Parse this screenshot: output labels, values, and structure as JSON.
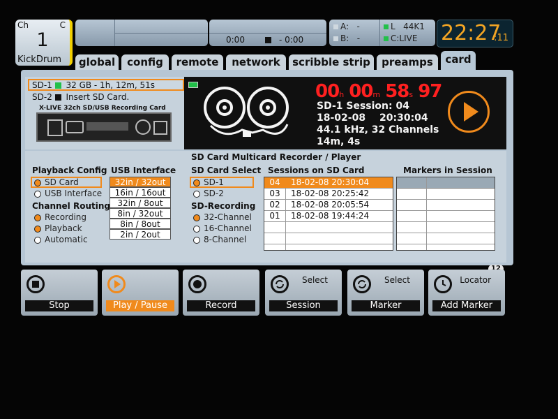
{
  "channel": {
    "ch_label": "Ch",
    "c_label": "C",
    "number": "1",
    "name": "KickDrum"
  },
  "transport": {
    "elapsed": "0:00",
    "remaining": "- 0:00"
  },
  "io": {
    "a_label": "A:",
    "a_val": "-",
    "b_label": "B:",
    "b_val": "-",
    "l_label": "L",
    "l_val": "44K1",
    "c_label": "C:",
    "c_val": "LIVE"
  },
  "clock": {
    "hm": "22:27",
    "s": ":11"
  },
  "tabs": [
    "global",
    "config",
    "remote",
    "network",
    "scribble strip",
    "preamps",
    "card"
  ],
  "sd_status": [
    {
      "label": "SD-1",
      "text": "32 GB - 1h, 12m, 51s",
      "status_color": "#22c04a"
    },
    {
      "label": "SD-2",
      "text": "Insert SD Card.",
      "status_color": "#111111"
    }
  ],
  "card_image_title": "X-LIVE 32ch SD/USB Recording Card",
  "battery_color": "#22c04a",
  "timer": {
    "h": "00",
    "h_unit": "h",
    "m": "00",
    "m_unit": "m",
    "s": "58",
    "s_unit": "s",
    "f": "97"
  },
  "session_info": {
    "line1": "SD-1 Session: 04",
    "date": "18-02-08",
    "time": "20:30:04",
    "line3": "44.1 kHz, 32 Channels",
    "line4": "14m,  4s"
  },
  "recorder_title": "SD Card Multicard Recorder / Player",
  "playback_config": {
    "title": "Playback Config",
    "options": [
      {
        "label": "SD Card",
        "selected": true
      },
      {
        "label": "USB Interface",
        "selected": false
      }
    ]
  },
  "channel_routing": {
    "title": "Channel Routing",
    "options": [
      {
        "label": "Recording",
        "selected": true
      },
      {
        "label": "Playback",
        "selected": true
      },
      {
        "label": "Automatic",
        "selected": false
      }
    ]
  },
  "usb_interface": {
    "title": "USB Interface",
    "options": [
      {
        "label": "32in / 32out",
        "selected": true
      },
      {
        "label": "16in / 16out",
        "selected": false
      },
      {
        "label": "32in / 8out",
        "selected": false
      },
      {
        "label": "8in / 32out",
        "selected": false
      },
      {
        "label": "8in / 8out",
        "selected": false
      },
      {
        "label": "2in / 2out",
        "selected": false
      }
    ]
  },
  "sd_card_select": {
    "title": "SD Card Select",
    "options": [
      {
        "label": "SD-1",
        "selected": true
      },
      {
        "label": "SD-2",
        "selected": false
      }
    ]
  },
  "sd_recording": {
    "title": "SD-Recording",
    "options": [
      {
        "label": "32-Channel",
        "selected": true
      },
      {
        "label": "16-Channel",
        "selected": false
      },
      {
        "label": "8-Channel",
        "selected": false
      }
    ]
  },
  "sessions": {
    "title": "Sessions on SD Card",
    "rows": [
      {
        "num": "04",
        "datetime": "18-02-08  20:30:04",
        "selected": true
      },
      {
        "num": "03",
        "datetime": "18-02-08  20:25:42",
        "selected": false
      },
      {
        "num": "02",
        "datetime": "18-02-08  20:05:54",
        "selected": false
      },
      {
        "num": "01",
        "datetime": "18-02-08  19:44:24",
        "selected": false
      }
    ]
  },
  "markers": {
    "title": "Markers in Session"
  },
  "page_indicator": "12",
  "buttons": [
    {
      "top": "",
      "label": "Stop",
      "icon": "stop-icon"
    },
    {
      "top": "",
      "label": "Play / Pause",
      "icon": "play-icon",
      "active": true
    },
    {
      "top": "",
      "label": "Record",
      "icon": "record-icon"
    },
    {
      "top": "Select",
      "label": "Session",
      "icon": "rotary-icon"
    },
    {
      "top": "Select",
      "label": "Marker",
      "icon": "rotary-icon"
    },
    {
      "top": "Locator",
      "label": "Add Marker",
      "icon": "clock-icon"
    }
  ],
  "colors": {
    "accent": "#f08a1c",
    "panel": "#b6c6d4",
    "display_bg": "#101010",
    "timer_red": "#ff2020",
    "clock_amber": "#f2a524"
  }
}
